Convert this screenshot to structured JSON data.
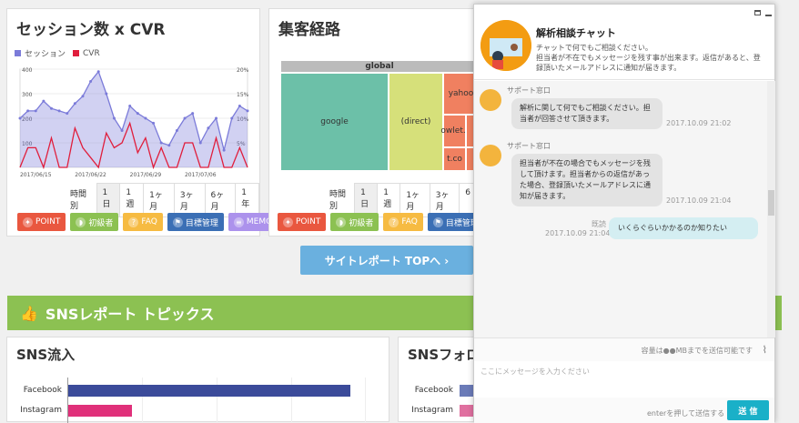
{
  "cvr_panel": {
    "title": "セッション数 x CVR",
    "legend": [
      "セッション",
      "CVR"
    ],
    "colors": {
      "sessions": "#7b7bd9",
      "cvr": "#e01e3c"
    },
    "y_left_ticks": [
      "400",
      "300",
      "200",
      "100"
    ],
    "y_right_ticks": [
      "20%",
      "15%",
      "10%",
      "5%"
    ],
    "x_ticks": [
      "2017/06/15",
      "2017/06/22",
      "2017/06/29",
      "2017/07/06"
    ]
  },
  "chart_data": [
    {
      "type": "area",
      "title": "セッション数 x CVR",
      "legend_position": "top-left",
      "categories": [
        "2017/06/13",
        "2017/06/14",
        "2017/06/15",
        "2017/06/16",
        "2017/06/17",
        "2017/06/18",
        "2017/06/19",
        "2017/06/20",
        "2017/06/21",
        "2017/06/22",
        "2017/06/23",
        "2017/06/24",
        "2017/06/25",
        "2017/06/26",
        "2017/06/27",
        "2017/06/28",
        "2017/06/29",
        "2017/06/30",
        "2017/07/01",
        "2017/07/02",
        "2017/07/03",
        "2017/07/04",
        "2017/07/05",
        "2017/07/06",
        "2017/07/07",
        "2017/07/08",
        "2017/07/09",
        "2017/07/10",
        "2017/07/11",
        "2017/07/12"
      ],
      "series": [
        {
          "name": "セッション",
          "axis": "left",
          "values": [
            200,
            230,
            230,
            270,
            240,
            230,
            220,
            260,
            290,
            350,
            390,
            300,
            200,
            150,
            250,
            220,
            200,
            180,
            100,
            90,
            150,
            200,
            220,
            100,
            160,
            200,
            70,
            200,
            250,
            230
          ]
        },
        {
          "name": "CVR",
          "axis": "right",
          "values": [
            0,
            4,
            4,
            0,
            6,
            0,
            0,
            8,
            4,
            2,
            0,
            7,
            4,
            5,
            9,
            3,
            6,
            0,
            4,
            0,
            0,
            5,
            5,
            0,
            0,
            6,
            0,
            0,
            4,
            0
          ]
        }
      ],
      "ylim_left": [
        0,
        400
      ],
      "ylim_right": [
        0,
        20
      ]
    }
  ],
  "time_bar": {
    "label": "時間別",
    "options": [
      "1日",
      "1週",
      "1ヶ月",
      "3ヶ月",
      "6ヶ月",
      "1年"
    ],
    "active": "1日"
  },
  "buttons": [
    {
      "label": "POINT",
      "icon": "lightbulb-icon",
      "color": "#e9573f"
    },
    {
      "label": "初級者",
      "icon": "beginner-icon",
      "color": "#8cc152"
    },
    {
      "label": "FAQ",
      "icon": "question-icon",
      "color": "#f6bb42"
    },
    {
      "label": "目標管理",
      "icon": "flag-icon",
      "color": "#3b6fb5"
    },
    {
      "label": "MEMO",
      "icon": "memo-icon",
      "color": "#ac92ec"
    }
  ],
  "route_panel": {
    "title": "集客経路",
    "treemap_root": "global",
    "tiles": [
      {
        "label": "google",
        "color": "#6cc0a8"
      },
      {
        "label": "(direct)",
        "color": "#d6e07a"
      },
      {
        "label": "yahoo",
        "color": "#f08060"
      },
      {
        "label": "owlet..",
        "color": "#f08060"
      },
      {
        "label": "t.co",
        "color": "#f08060"
      }
    ]
  },
  "route_time_bar": {
    "label": "時間別",
    "options": [
      "1日",
      "1週",
      "1ヶ月",
      "3ヶ月",
      "6"
    ],
    "active": "1日"
  },
  "site_report_button": "サイトレポート TOPへ ›",
  "sns_banner": "SNSレポート トピックス",
  "sns_inflow": {
    "title": "SNS流入",
    "bars": [
      {
        "label": "Facebook",
        "value": 100,
        "color": "#3b4b9a"
      },
      {
        "label": "Instagram",
        "value": 22,
        "color": "#e0307a"
      }
    ]
  },
  "sns_follow": {
    "title": "SNSフォロ",
    "bars": [
      {
        "label": "Facebook",
        "color": "#6b7bb8"
      },
      {
        "label": "Instagram",
        "color": "#e070a0"
      }
    ]
  },
  "chat": {
    "title": "解析相談チャット",
    "subtitle": "チャットで何でもご相談ください。",
    "description": "担当者が不在でもメッセージを残す事が出来ます。返信があると、登録頂いたメールアドレスに通知が届きます。",
    "header_icons": [
      "minimize-window-icon",
      "minimize-icon"
    ],
    "messages": [
      {
        "sender": "サポート窓口",
        "text": "解析に関して何でもご相談ください。担当者が回答させて頂きます。",
        "time": "2017.10.09 21:02"
      },
      {
        "sender": "サポート窓口",
        "text": "担当者が不在の場合でもメッセージを残して頂けます。担当者からの返信があった場合、登録頂いたメールアドレスに通知が届きます。",
        "time": "2017.10.09 21:04"
      },
      {
        "status": "既読",
        "time": "2017.10.09 21:04",
        "text": "いくらぐらいかかるのか知りたい"
      }
    ],
    "attach_note": "容量は●●MBまでを送信可能です",
    "input_placeholder": "ここにメッセージを入力ください",
    "send_hint": "enterを押して送信する",
    "send_label": "送 信"
  }
}
